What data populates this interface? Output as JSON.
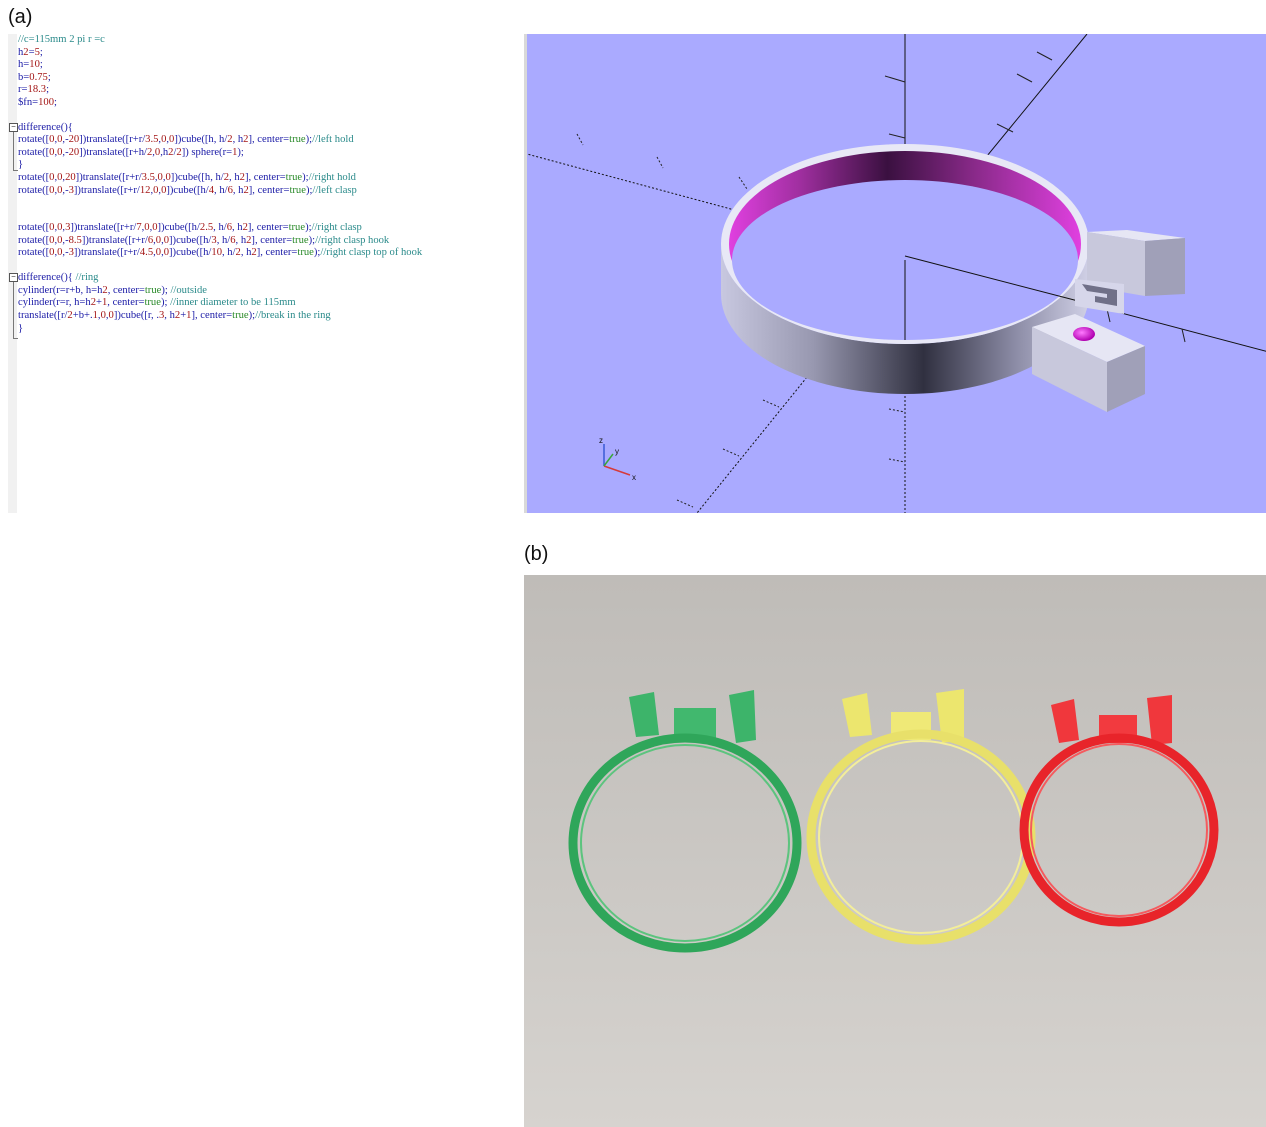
{
  "panel_a_label": "(a)",
  "panel_b_label": "(b)",
  "editor": {
    "lines": [
      "//c=115mm 2 pi r =c",
      "h2=5;",
      "h=10;",
      "b=0.75;",
      "r=18.3;",
      "$fn=100;",
      "",
      "difference(){",
      "rotate([0,0,-20])translate([r+r/3.5,0,0])cube([h, h/2, h2], center=true);//left hold",
      "rotate([0,0,-20])translate([r+h/2,0,h2/2]) sphere(r=1);",
      "}",
      "rotate([0,0,20])translate([r+r/3.5,0,0])cube([h, h/2, h2], center=true);//right hold",
      "rotate([0,0,-3])translate([r+r/12,0,0])cube([h/4, h/6, h2], center=true);//left clasp",
      "",
      "",
      "rotate([0,0,3])translate([r+r/7,0,0])cube([h/2.5, h/6, h2], center=true);//right clasp",
      "rotate([0,0,-8.5])translate([r+r/6,0,0])cube([h/3, h/6, h2], center=true);//right clasp hook",
      "rotate([0,0,-3])translate([r+r/4.5,0,0])cube([h/10, h/2, h2], center=true);//right clasp top of hook",
      "",
      "difference(){ //ring",
      "cylinder(r=r+b, h=h2, center=true); //outside",
      "cylinder(r=r, h=h2+1, center=true); //inner diameter to be 115mm",
      "translate([r/2+b+.1,0,0])cube([r, .3, h2+1], center=true);//break in the ring",
      "}"
    ]
  },
  "viewport": {
    "background": "#aaaaff",
    "axes_labels": {
      "x": "x",
      "y": "y",
      "z": "z"
    }
  },
  "photo": {
    "rings": [
      "green",
      "yellow",
      "red"
    ],
    "colors": {
      "green": "#2fa65a",
      "yellow": "#e8e06a",
      "red": "#e8242a",
      "background": "#c9c6c2"
    }
  }
}
